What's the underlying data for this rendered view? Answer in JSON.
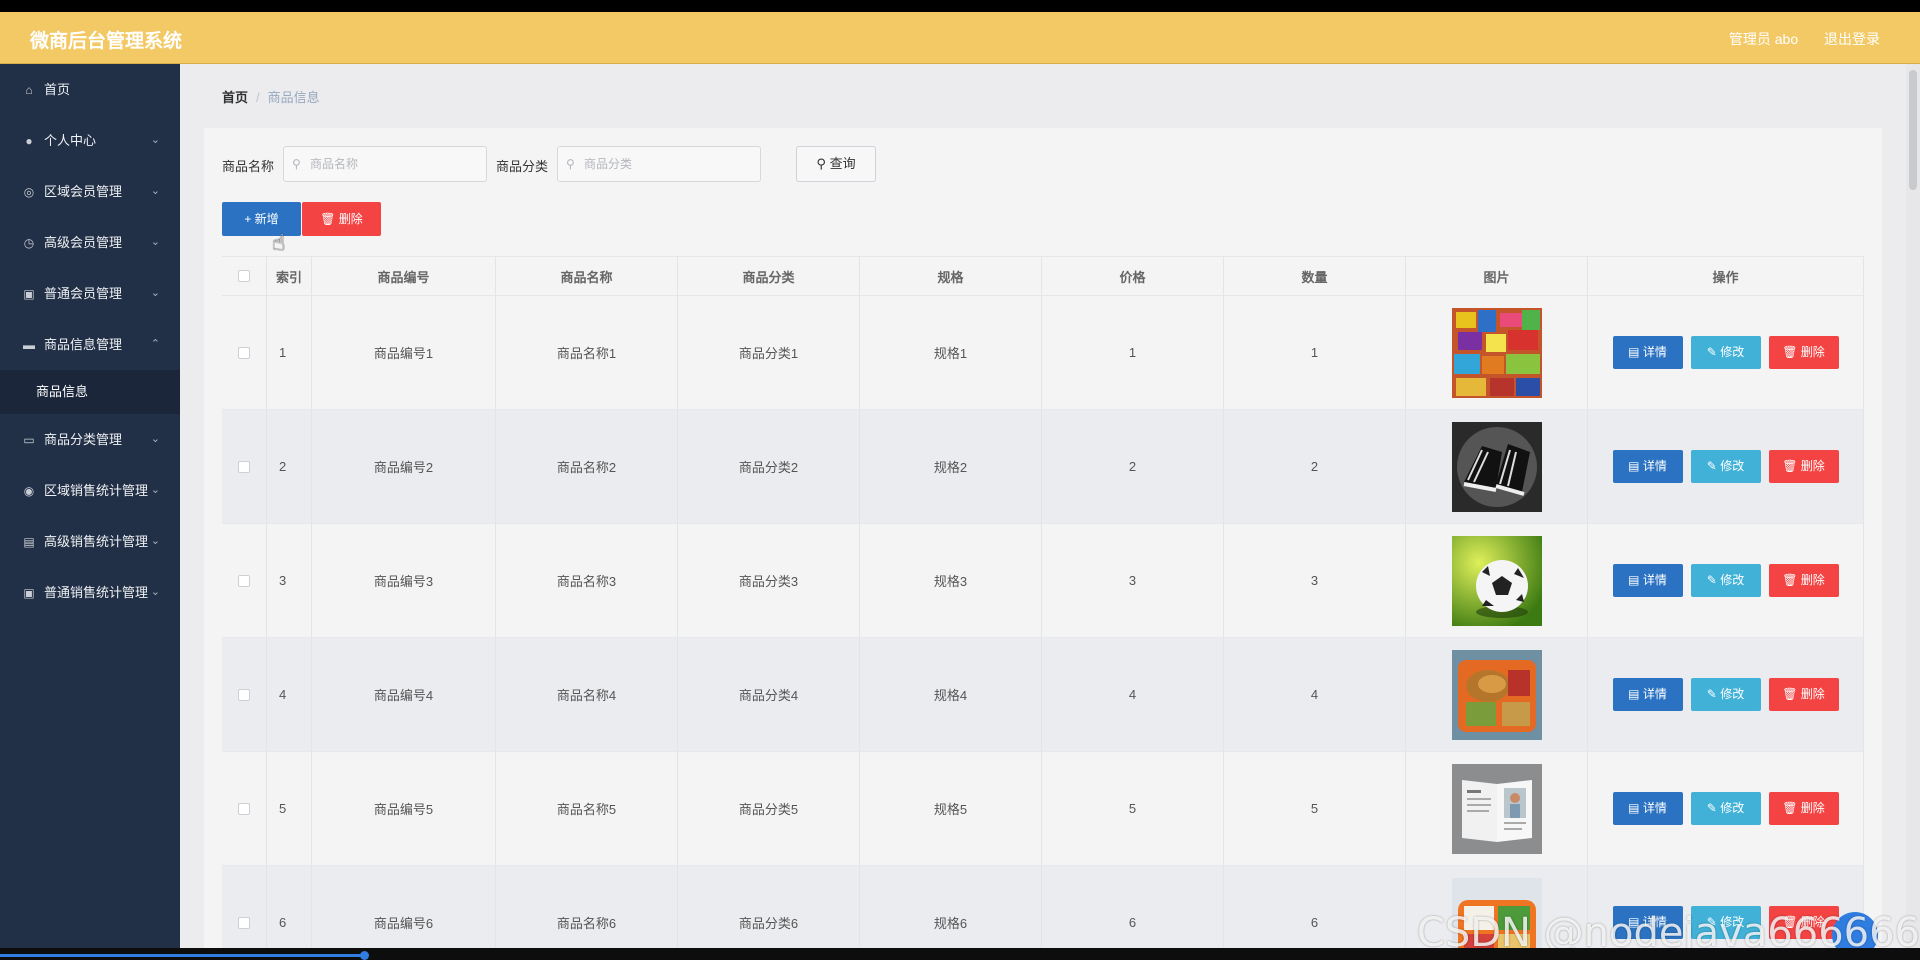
{
  "header": {
    "title": "微商后台管理系统",
    "user_label": "管理员 abo",
    "logout_label": "退出登录"
  },
  "sidebar": {
    "items": [
      {
        "label": "首页",
        "icon": "home-icon",
        "has_children": false
      },
      {
        "label": "个人中心",
        "icon": "user-icon",
        "has_children": true
      },
      {
        "label": "区域会员管理",
        "icon": "compass-icon",
        "has_children": true
      },
      {
        "label": "高级会员管理",
        "icon": "clock-icon",
        "has_children": true
      },
      {
        "label": "普通会员管理",
        "icon": "clipboard-icon",
        "has_children": true
      },
      {
        "label": "商品信息管理",
        "icon": "message-icon",
        "has_children": true,
        "expanded": true
      },
      {
        "label": "商品分类管理",
        "icon": "chat-icon",
        "has_children": true
      },
      {
        "label": "区域销售统计管理",
        "icon": "location-icon",
        "has_children": true
      },
      {
        "label": "高级销售统计管理",
        "icon": "briefcase-icon",
        "has_children": true
      },
      {
        "label": "普通销售统计管理",
        "icon": "clipboard-icon",
        "has_children": true
      }
    ],
    "active_subitem": "商品信息"
  },
  "breadcrumb": {
    "home": "首页",
    "separator": "/",
    "current": "商品信息"
  },
  "search": {
    "name_label": "商品名称",
    "name_placeholder": "商品名称",
    "category_label": "商品分类",
    "category_placeholder": "商品分类",
    "query_button": "查询"
  },
  "actions": {
    "add_button": "+ 新增",
    "delete_button": "删除"
  },
  "table": {
    "columns": [
      "索引",
      "商品编号",
      "商品名称",
      "商品分类",
      "规格",
      "价格",
      "数量",
      "图片",
      "操作"
    ],
    "rows": [
      {
        "index": "1",
        "code": "商品编号1",
        "name": "商品名称1",
        "category": "商品分类1",
        "spec": "规格1",
        "price": "1",
        "qty": "1",
        "image": "snacks-pile"
      },
      {
        "index": "2",
        "code": "商品编号2",
        "name": "商品名称2",
        "category": "商品分类2",
        "spec": "规格2",
        "price": "2",
        "qty": "2",
        "image": "black-sneakers"
      },
      {
        "index": "3",
        "code": "商品编号3",
        "name": "商品名称3",
        "category": "商品分类3",
        "spec": "规格3",
        "price": "3",
        "qty": "3",
        "image": "soccer-ball"
      },
      {
        "index": "4",
        "code": "商品编号4",
        "name": "商品名称4",
        "category": "商品分类4",
        "spec": "规格4",
        "price": "4",
        "qty": "4",
        "image": "fried-food-tray"
      },
      {
        "index": "5",
        "code": "商品编号5",
        "name": "商品名称5",
        "category": "商品分类5",
        "spec": "规格5",
        "price": "5",
        "qty": "5",
        "image": "open-magazine"
      },
      {
        "index": "6",
        "code": "商品编号6",
        "name": "商品名称6",
        "category": "商品分类6",
        "spec": "规格6",
        "price": "6",
        "qty": "6",
        "image": "lunch-box"
      }
    ],
    "row_actions": {
      "detail": "详情",
      "edit": "修改",
      "delete": "删除"
    }
  },
  "watermark": "CSDN @nodejava666666",
  "colors": {
    "header_bg": "#f3c965",
    "sidebar_bg": "#223047",
    "primary": "#2b73c2",
    "info": "#41b1d8",
    "danger": "#f34343"
  }
}
